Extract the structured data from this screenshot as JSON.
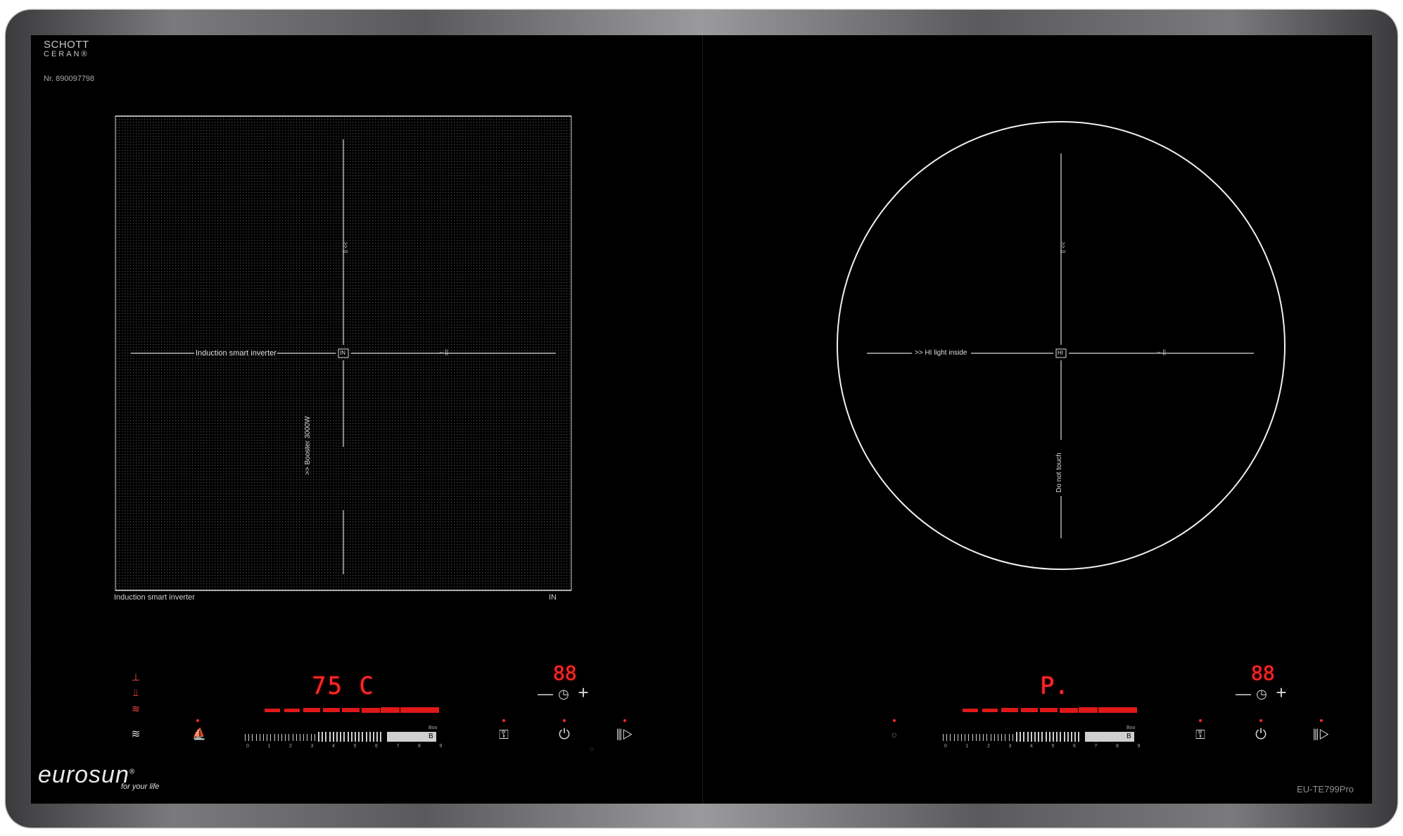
{
  "brand": {
    "line1": "SCHOTT",
    "line2": "CERAN®",
    "serial": "Nr. 890097798"
  },
  "logo": {
    "name": "eurosun",
    "registered": "®",
    "tagline": "for your life"
  },
  "model": "EU-TE799Pro",
  "left_zone": {
    "center_label": "IN",
    "horizontal_label": "Induction smart inverter",
    "vertical_label": ">> Booster 3000W",
    "caption_left": "Induction smart inverter",
    "caption_right": "IN",
    "arrow_top": ">> ||",
    "arrow_right": "⌣ ||"
  },
  "right_zone": {
    "center_label": "HI",
    "horizontal_label": ">> HI light inside",
    "vertical_label": "Do not touch",
    "arrow_top": ">> ||",
    "arrow_right": "⌣ ||"
  },
  "left_controls": {
    "temp_display": "75 C",
    "timer_display": "88",
    "timer_minus": "—",
    "timer_plus": "+",
    "slider_numbers": [
      "0",
      "1",
      "2",
      "3",
      "4",
      "5",
      "6",
      "7",
      "8",
      "9"
    ],
    "slider_boost": "B",
    "slider_boost_small": "Boo",
    "power_on": true
  },
  "right_controls": {
    "power_display": "P.",
    "timer_display": "88",
    "timer_minus": "—",
    "timer_plus": "+",
    "slider_numbers": [
      "0",
      "1",
      "2",
      "3",
      "4",
      "5",
      "6",
      "7",
      "8",
      "9"
    ],
    "slider_boost": "B",
    "slider_boost_small": "Boo"
  },
  "icons": {
    "heat_levels": "heat-level-icon",
    "keep_warm": "keep-warm-icon",
    "pan": "pan-icon",
    "lock": "key-lock-icon",
    "power": "power-icon",
    "pause": "pause-icon"
  }
}
